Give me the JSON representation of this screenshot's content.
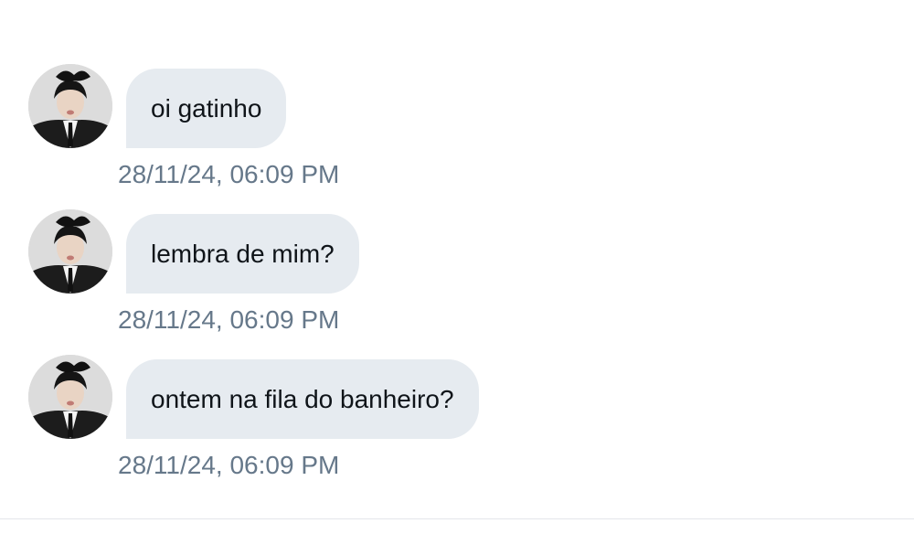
{
  "conversation": {
    "messages": [
      {
        "text": "oi gatinho",
        "timestamp": "28/11/24, 06:09 PM"
      },
      {
        "text": "lembra de mim?",
        "timestamp": "28/11/24, 06:09 PM"
      },
      {
        "text": "ontem na fila do banheiro?",
        "timestamp": "28/11/24, 06:09 PM"
      }
    ]
  },
  "colors": {
    "bubble_background": "#e6ebf0",
    "message_text": "#0f1419",
    "timestamp_text": "#66788a",
    "page_background": "#ffffff"
  },
  "icons": {
    "avatar": "sender-avatar-photo"
  }
}
